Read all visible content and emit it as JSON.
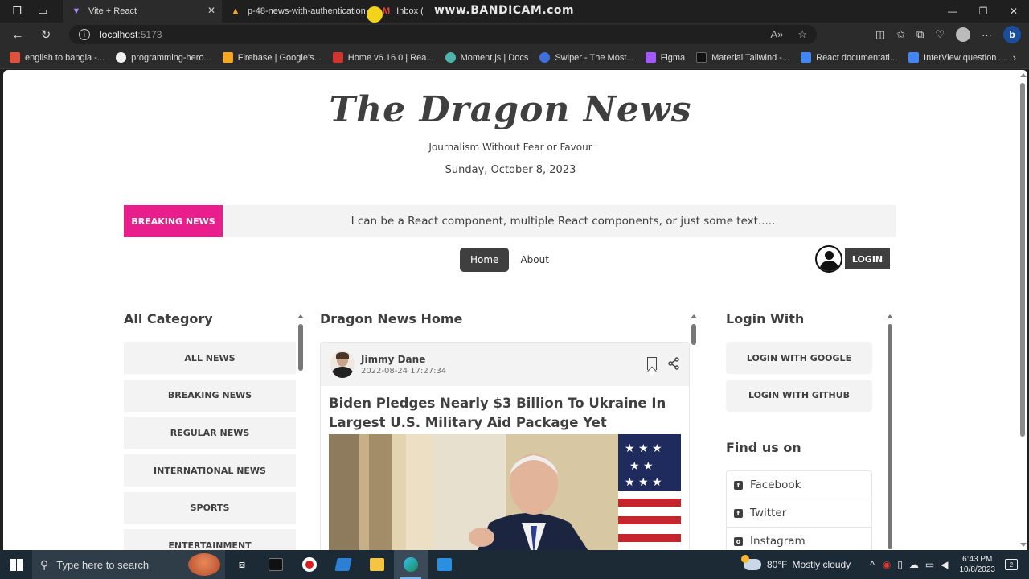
{
  "browser": {
    "tabs": [
      {
        "label": "Vite + React",
        "active": true
      },
      {
        "label": "p-48-news-with-authentication",
        "active": false
      },
      {
        "label": "Inbox (2",
        "active": false
      }
    ],
    "watermark": "www.BANDICAM.com",
    "url_host": "localhost",
    "url_port": ":5173",
    "bookmarks": [
      {
        "label": "english to bangla -...",
        "color": "#e0513b"
      },
      {
        "label": "programming-hero...",
        "color": "#f0f0f0"
      },
      {
        "label": "Firebase | Google's...",
        "color": "#f5a623"
      },
      {
        "label": "Home v6.16.0 | Rea...",
        "color": "#d0342c"
      },
      {
        "label": "Moment.js | Docs",
        "color": "#4db6ac"
      },
      {
        "label": "Swiper - The Most...",
        "color": "#3f6fe0"
      },
      {
        "label": "Figma",
        "color": "#a259ff"
      },
      {
        "label": "Material Tailwind -...",
        "color": "#222222"
      },
      {
        "label": "React documentati...",
        "color": "#4285f4"
      },
      {
        "label": "InterView question ...",
        "color": "#4285f4"
      }
    ]
  },
  "site": {
    "logo": "The Dragon News",
    "tagline": "Journalism Without Fear or Favour",
    "date": "Sunday, October 8, 2023",
    "breaking_label": "BREAKING NEWS",
    "breaking_text": "I can be a React component, multiple React components, or just some text.....",
    "nav": {
      "home": "Home",
      "about": "About"
    },
    "login_label": "LOGIN",
    "accent": "#e91e8c",
    "dark": "#403f3f"
  },
  "left": {
    "title": "All Category",
    "categories": [
      "ALL NEWS",
      "BREAKING NEWS",
      "REGULAR NEWS",
      "INTERNATIONAL NEWS",
      "SPORTS",
      "ENTERTAINMENT"
    ]
  },
  "center": {
    "title": "Dragon News Home",
    "news": {
      "author": "Jimmy Dane",
      "published": "2022-08-24 17:27:34",
      "headline": "Biden Pledges Nearly $3 Billion To Ukraine In Largest U.S. Military Aid Package Yet"
    }
  },
  "right": {
    "login_title": "Login With",
    "google": "LOGIN WITH GOOGLE",
    "github": "LOGIN WITH GITHUB",
    "find_title": "Find us on",
    "social": [
      {
        "label": "Facebook",
        "icon": "facebook-icon",
        "glyph": "f"
      },
      {
        "label": "Twitter",
        "icon": "twitter-icon",
        "glyph": "t"
      },
      {
        "label": "Instagram",
        "icon": "instagram-icon",
        "glyph": "o"
      }
    ]
  },
  "taskbar": {
    "search_placeholder": "Type here to search",
    "weather_temp": "80°F",
    "weather_desc": "Mostly cloudy",
    "time": "6:43 PM",
    "date": "10/8/2023",
    "notifications": "2"
  }
}
